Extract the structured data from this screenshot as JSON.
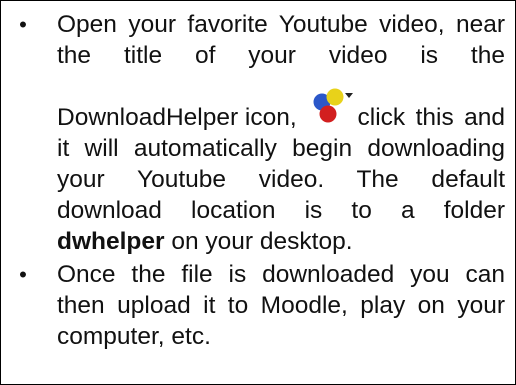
{
  "items": [
    {
      "line_a": "Open your favorite Youtube video, near the title of your video is the",
      "line_b": "DownloadHelper icon,",
      "line_c": "click this and it will automatically begin downloading your Youtube video. The default download location is to a folder",
      "bold_word": "dwhelper",
      "line_d": "on your desktop."
    },
    {
      "text": "Once the file is downloaded you can then upload it to Moodle, play on your computer, etc."
    }
  ],
  "icon": {
    "name": "downloadhelper-icon",
    "colors": {
      "blue": "#2b57c9",
      "red": "#d21f1f",
      "yellow": "#e8d21a",
      "arrow": "#222222"
    }
  }
}
